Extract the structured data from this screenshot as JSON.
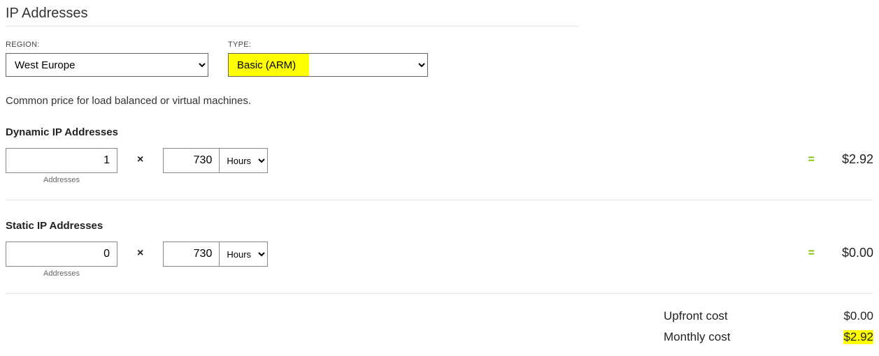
{
  "header": {
    "title": "IP Addresses"
  },
  "fields": {
    "region": {
      "label": "REGION:",
      "value": "West Europe"
    },
    "type": {
      "label": "TYPE:",
      "value": "Basic (ARM)"
    }
  },
  "description": "Common price for load balanced or virtual machines.",
  "sections": {
    "dynamic": {
      "title": "Dynamic IP Addresses",
      "addresses": "1",
      "addresses_label": "Addresses",
      "hours": "730",
      "unit": "Hours",
      "equals": "=",
      "times": "×",
      "price": "$2.92"
    },
    "static": {
      "title": "Static IP Addresses",
      "addresses": "0",
      "addresses_label": "Addresses",
      "hours": "730",
      "unit": "Hours",
      "equals": "=",
      "times": "×",
      "price": "$0.00"
    }
  },
  "totals": {
    "upfront_label": "Upfront cost",
    "upfront_value": "$0.00",
    "monthly_label": "Monthly cost",
    "monthly_value": "$2.92"
  }
}
